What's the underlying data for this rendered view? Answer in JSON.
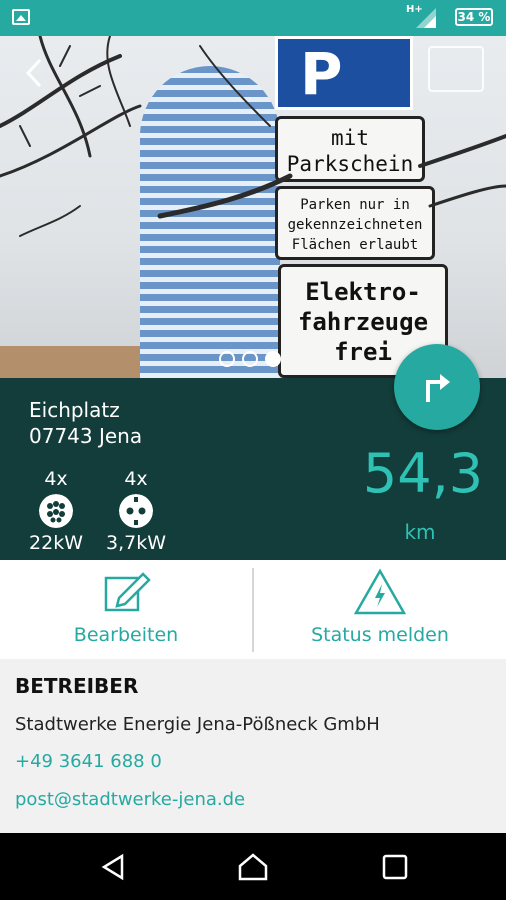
{
  "status_bar": {
    "network": "H+",
    "battery": "34 %"
  },
  "station": {
    "street": "Eichplatz",
    "city": "07743 Jena",
    "plugs": [
      {
        "count": "4x",
        "power": "22kW",
        "icon": "type2-plug-icon"
      },
      {
        "count": "4x",
        "power": "3,7kW",
        "icon": "schuko-plug-icon"
      }
    ],
    "distance": "54,3",
    "distance_unit": "km"
  },
  "photo_signs": {
    "sign_p": "P",
    "sign1": [
      "mit",
      "Parkschein"
    ],
    "sign2": [
      "Parken nur in",
      "gekennzeichneten",
      "Flächen erlaubt"
    ],
    "sign3": [
      "Elektro-",
      "fahrzeuge",
      "frei"
    ]
  },
  "gallery": {
    "pages": 3,
    "active": 2
  },
  "actions": {
    "edit_label": "Bearbeiten",
    "report_label": "Status melden"
  },
  "operator": {
    "title": "BETREIBER",
    "name": "Stadtwerke Energie Jena-Pößneck GmbH",
    "phone": "+49 3641 688 0",
    "email": "post@stadtwerke-jena.de"
  },
  "colors": {
    "accent": "#26a9a0",
    "dark_panel": "#133d3a",
    "accent_text": "#2fc1b4"
  }
}
